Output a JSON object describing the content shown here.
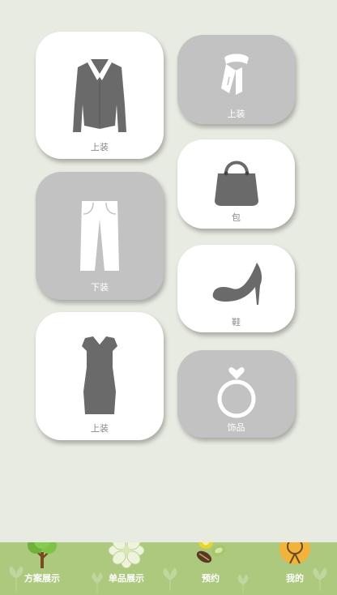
{
  "tiles": [
    {
      "label": "上装",
      "icon": "jacket-icon"
    },
    {
      "label": "上装",
      "icon": "scarf-icon"
    },
    {
      "label": "包",
      "icon": "handbag-icon"
    },
    {
      "label": "下装",
      "icon": "trousers-icon"
    },
    {
      "label": "鞋",
      "icon": "high-heel-icon"
    },
    {
      "label": "上装",
      "icon": "dress-icon"
    },
    {
      "label": "饰品",
      "icon": "ring-icon"
    }
  ],
  "nav": [
    {
      "label": "方案展示",
      "icon": "tree-icon"
    },
    {
      "label": "单品展示",
      "icon": "flower-icon"
    },
    {
      "label": "预约",
      "icon": "seeds-icon"
    },
    {
      "label": "我的",
      "icon": "straw-hat-icon"
    }
  ],
  "colors": {
    "background": "#e8ebe1",
    "tile_white": "#ffffff",
    "tile_gray": "#c2c2c2",
    "icon_gray": "#6a6a6a",
    "bottom_bar": "#adc97e"
  }
}
